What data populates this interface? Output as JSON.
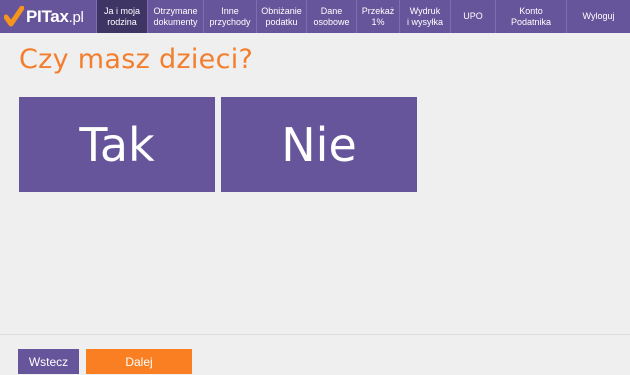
{
  "brand": {
    "name": "PITax",
    "suffix": ".pl",
    "accent": "#f7941d"
  },
  "nav": {
    "items": [
      {
        "line1": "Ja i moja",
        "line2": "rodzina",
        "active": true
      },
      {
        "line1": "Otrzymane",
        "line2": "dokumenty",
        "active": false
      },
      {
        "line1": "Inne",
        "line2": "przychody",
        "active": false
      },
      {
        "line1": "Obniżanie",
        "line2": "podatku",
        "active": false
      },
      {
        "line1": "Dane",
        "line2": "osobowe",
        "active": false
      },
      {
        "line1": "Przekaż",
        "line2": "1%",
        "active": false
      },
      {
        "line1": "Wydruk",
        "line2": "i wysyłka",
        "active": false
      },
      {
        "line1": "UPO",
        "line2": "",
        "active": false
      },
      {
        "line1": "Konto",
        "line2": "Podatnika",
        "active": false
      },
      {
        "line1": "Wyloguj",
        "line2": "",
        "active": false
      }
    ]
  },
  "main": {
    "question": "Czy masz dzieci?",
    "answers": {
      "yes": "Tak",
      "no": "Nie"
    }
  },
  "footer": {
    "back_label": "Wstecz",
    "next_label": "Dalej"
  },
  "colors": {
    "primary": "#66559a",
    "primary_dark": "#3f3565",
    "accent": "#f97f22",
    "question": "#f37e2d",
    "background": "#efefef"
  }
}
